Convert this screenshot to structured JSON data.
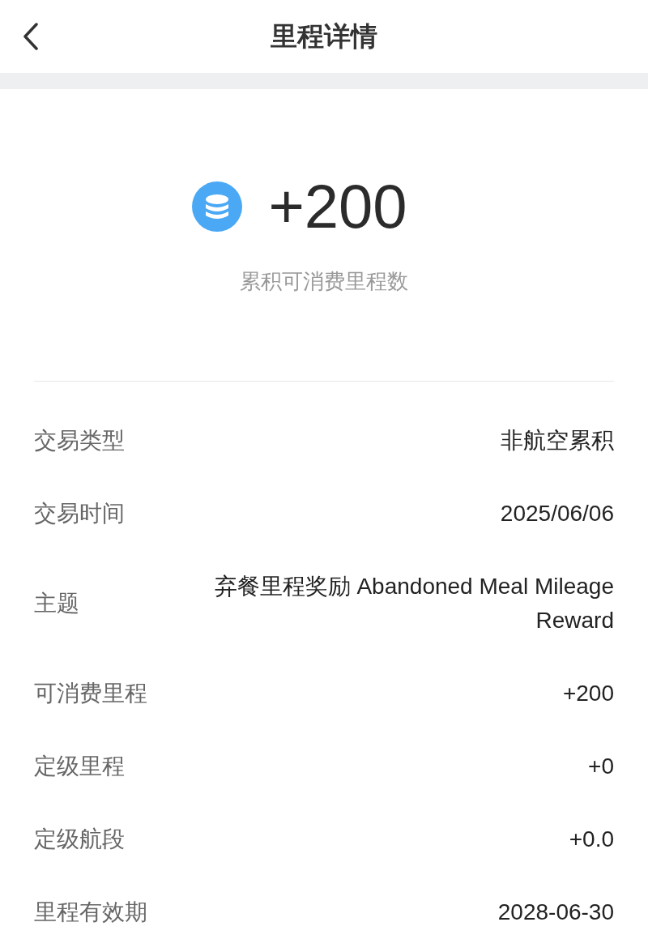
{
  "header": {
    "title": "里程详情"
  },
  "summary": {
    "amount": "+200",
    "caption": "累积可消费里程数"
  },
  "details": [
    {
      "label": "交易类型",
      "value": "非航空累积"
    },
    {
      "label": "交易时间",
      "value": "2025/06/06"
    },
    {
      "label": "主题",
      "value": "弃餐里程奖励 Abandoned Meal Mileage Reward"
    },
    {
      "label": "可消费里程",
      "value": "+200"
    },
    {
      "label": "定级里程",
      "value": "+0"
    },
    {
      "label": "定级航段",
      "value": "+0.0"
    },
    {
      "label": "里程有效期",
      "value": "2028-06-30"
    }
  ]
}
